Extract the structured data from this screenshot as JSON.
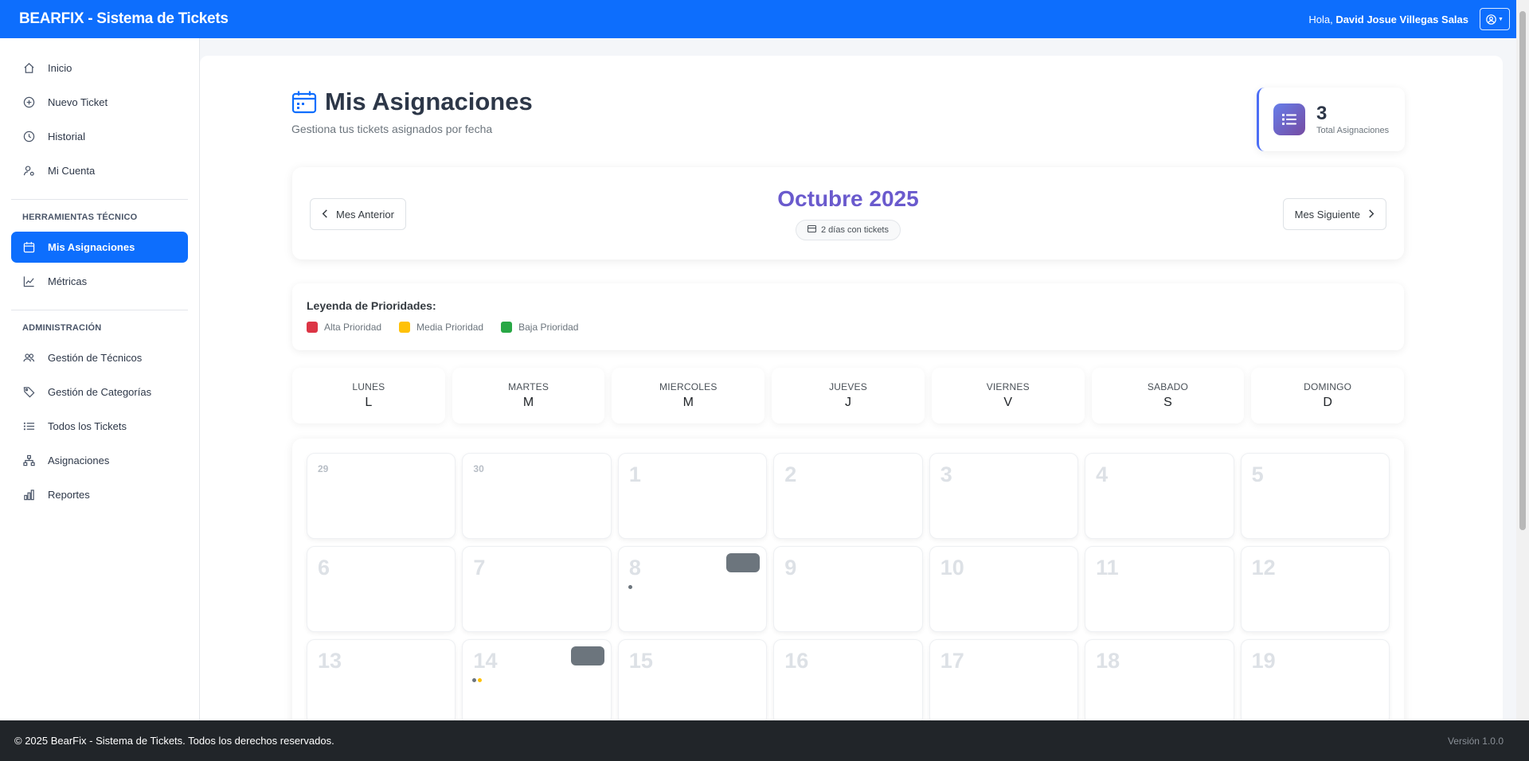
{
  "app": {
    "brand": "BEARFIX - Sistema de Tickets"
  },
  "header": {
    "greeting": "Hola,",
    "user_name": "David Josue Villegas Salas"
  },
  "sidebar": {
    "items": [
      {
        "label": "Inicio",
        "icon": "home-icon"
      },
      {
        "label": "Nuevo Ticket",
        "icon": "plus-circle-icon"
      },
      {
        "label": "Historial",
        "icon": "clock-icon"
      },
      {
        "label": "Mi Cuenta",
        "icon": "user-gear-icon"
      }
    ],
    "tech_heading": "HERRAMIENTAS TÉCNICO",
    "tech_items": [
      {
        "label": "Mis Asignaciones",
        "icon": "calendar-icon",
        "active": true
      },
      {
        "label": "Métricas",
        "icon": "line-chart-icon"
      }
    ],
    "admin_heading": "ADMINISTRACIÓN",
    "admin_items": [
      {
        "label": "Gestión de Técnicos",
        "icon": "users-icon"
      },
      {
        "label": "Gestión de Categorías",
        "icon": "tags-icon"
      },
      {
        "label": "Todos los Tickets",
        "icon": "list-icon"
      },
      {
        "label": "Asignaciones",
        "icon": "sitemap-icon"
      },
      {
        "label": "Reportes",
        "icon": "bar-chart-icon"
      }
    ]
  },
  "page": {
    "title": "Mis Asignaciones",
    "subtitle": "Gestiona tus tickets asignados por fecha"
  },
  "stats": {
    "total_value": "3",
    "total_label": "Total Asignaciones"
  },
  "calendar": {
    "month_title": "Octubre 2025",
    "days_with_tickets": "2 días con tickets",
    "prev_label": "Mes Anterior",
    "next_label": "Mes Siguiente",
    "weekdays": [
      {
        "name": "LUNES",
        "abbr": "L"
      },
      {
        "name": "MARTES",
        "abbr": "M"
      },
      {
        "name": "MIERCOLES",
        "abbr": "M"
      },
      {
        "name": "JUEVES",
        "abbr": "J"
      },
      {
        "name": "VIERNES",
        "abbr": "V"
      },
      {
        "name": "SABADO",
        "abbr": "S"
      },
      {
        "name": "DOMINGO",
        "abbr": "D"
      }
    ],
    "days": [
      {
        "num": "29",
        "other": true
      },
      {
        "num": "30",
        "other": true
      },
      {
        "num": "1"
      },
      {
        "num": "2"
      },
      {
        "num": "3"
      },
      {
        "num": "4"
      },
      {
        "num": "5"
      },
      {
        "num": "6"
      },
      {
        "num": "7"
      },
      {
        "num": "8",
        "badge": true,
        "dots": [
          "#6c757d"
        ]
      },
      {
        "num": "9"
      },
      {
        "num": "10"
      },
      {
        "num": "11"
      },
      {
        "num": "12"
      },
      {
        "num": "13"
      },
      {
        "num": "14",
        "badge": true,
        "dots": [
          "#6c757d",
          "#ffc107"
        ]
      },
      {
        "num": "15"
      },
      {
        "num": "16"
      },
      {
        "num": "17"
      },
      {
        "num": "18"
      },
      {
        "num": "19"
      }
    ]
  },
  "legend": {
    "title": "Leyenda de Prioridades:",
    "items": [
      {
        "label": "Alta Prioridad",
        "color": "#dc3545"
      },
      {
        "label": "Media Prioridad",
        "color": "#ffc107"
      },
      {
        "label": "Baja Prioridad",
        "color": "#28a745"
      }
    ]
  },
  "footer": {
    "copyright": "© 2025 BearFix - Sistema de Tickets. Todos los derechos reservados.",
    "version": "Versión 1.0.0"
  },
  "colors": {
    "primary": "#0d6efd",
    "month_title": "#6a5acd",
    "badge": "#6c757d"
  }
}
